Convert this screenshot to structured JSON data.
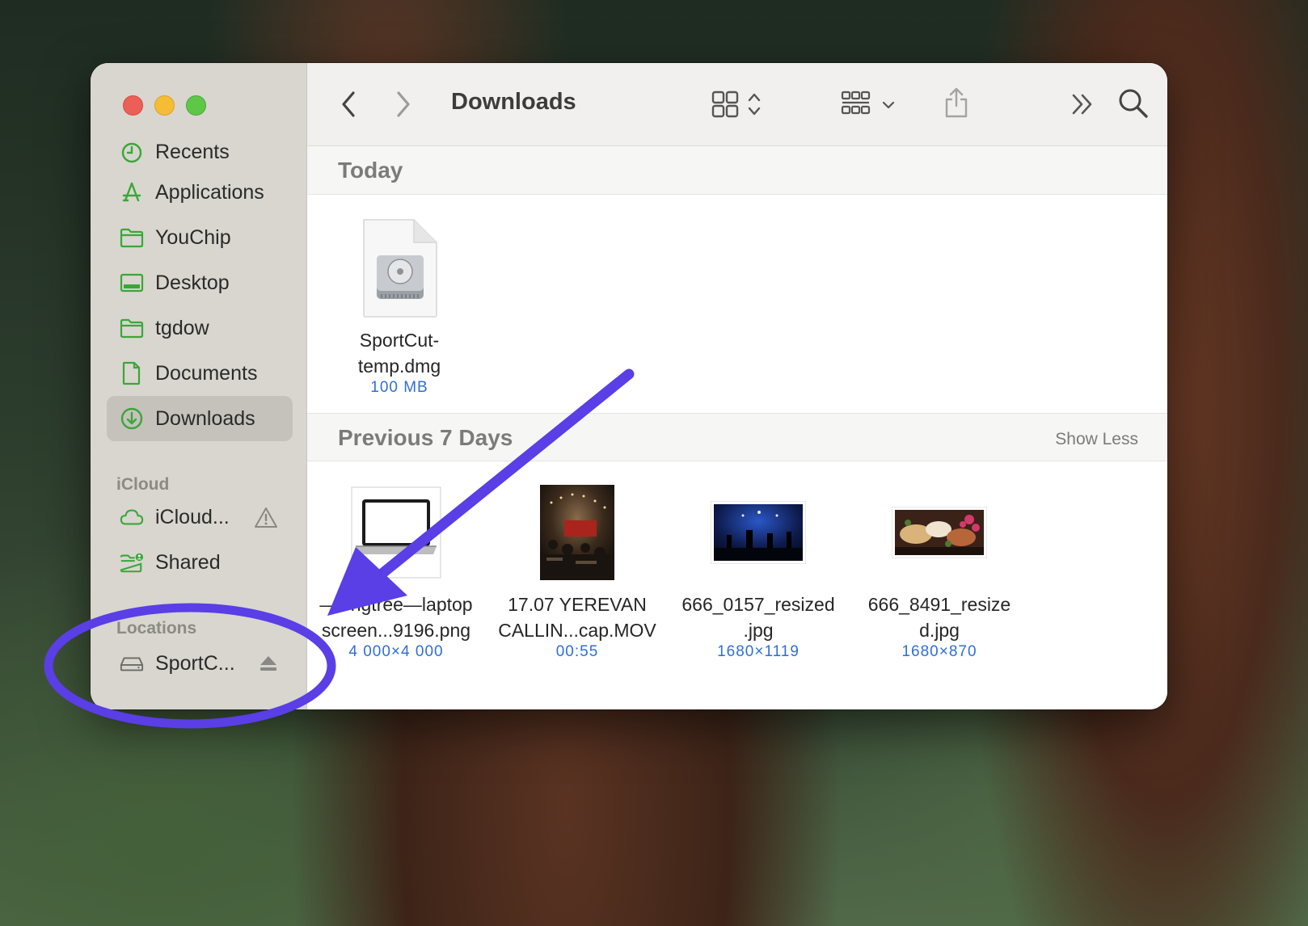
{
  "window": {
    "title": "Downloads"
  },
  "sidebar": {
    "favorites": [
      {
        "label": "Recents",
        "icon": "clock-icon"
      },
      {
        "label": "Applications",
        "icon": "applications-icon"
      },
      {
        "label": "YouChip",
        "icon": "folder-icon"
      },
      {
        "label": "Desktop",
        "icon": "desktop-icon"
      },
      {
        "label": "tgdow",
        "icon": "folder-icon"
      },
      {
        "label": "Documents",
        "icon": "document-icon"
      },
      {
        "label": "Downloads",
        "icon": "download-icon",
        "selected": true
      }
    ],
    "icloud_header": "iCloud",
    "icloud": [
      {
        "label": "iCloud...",
        "icon": "cloud-icon",
        "trail_icon": "warning-icon"
      },
      {
        "label": "Shared",
        "icon": "shared-folder-icon"
      }
    ],
    "locations_header": "Locations",
    "locations": [
      {
        "label": "SportC...",
        "icon": "drive-icon",
        "trail_icon": "eject-icon"
      }
    ]
  },
  "groups": {
    "today": {
      "title": "Today",
      "files": [
        {
          "name": "SportCut-\ntemp.dmg",
          "meta": "100 MB",
          "thumb": "disk-image-icon"
        }
      ]
    },
    "previous": {
      "title": "Previous 7 Days",
      "action": "Show Less",
      "files": [
        {
          "name": "—Pngtree—laptop\nscreen...9196.png",
          "meta": "4 000×4 000",
          "thumb": "laptop-thumbnail"
        },
        {
          "name": "17.07 YEREVAN\nCALLIN...cap.MOV",
          "meta": "00:55",
          "thumb": "video-thumbnail"
        },
        {
          "name": "666_0157_resized\n.jpg",
          "meta": "1680×1119",
          "thumb": "concert-thumbnail"
        },
        {
          "name": "666_8491_resize\nd.jpg",
          "meta": "1680×870",
          "thumb": "food-thumbnail"
        }
      ]
    }
  },
  "colors": {
    "accent": "#2f6fd6",
    "sidebar_icon": "#3aa63a",
    "annotation": "#5a3ee6"
  }
}
